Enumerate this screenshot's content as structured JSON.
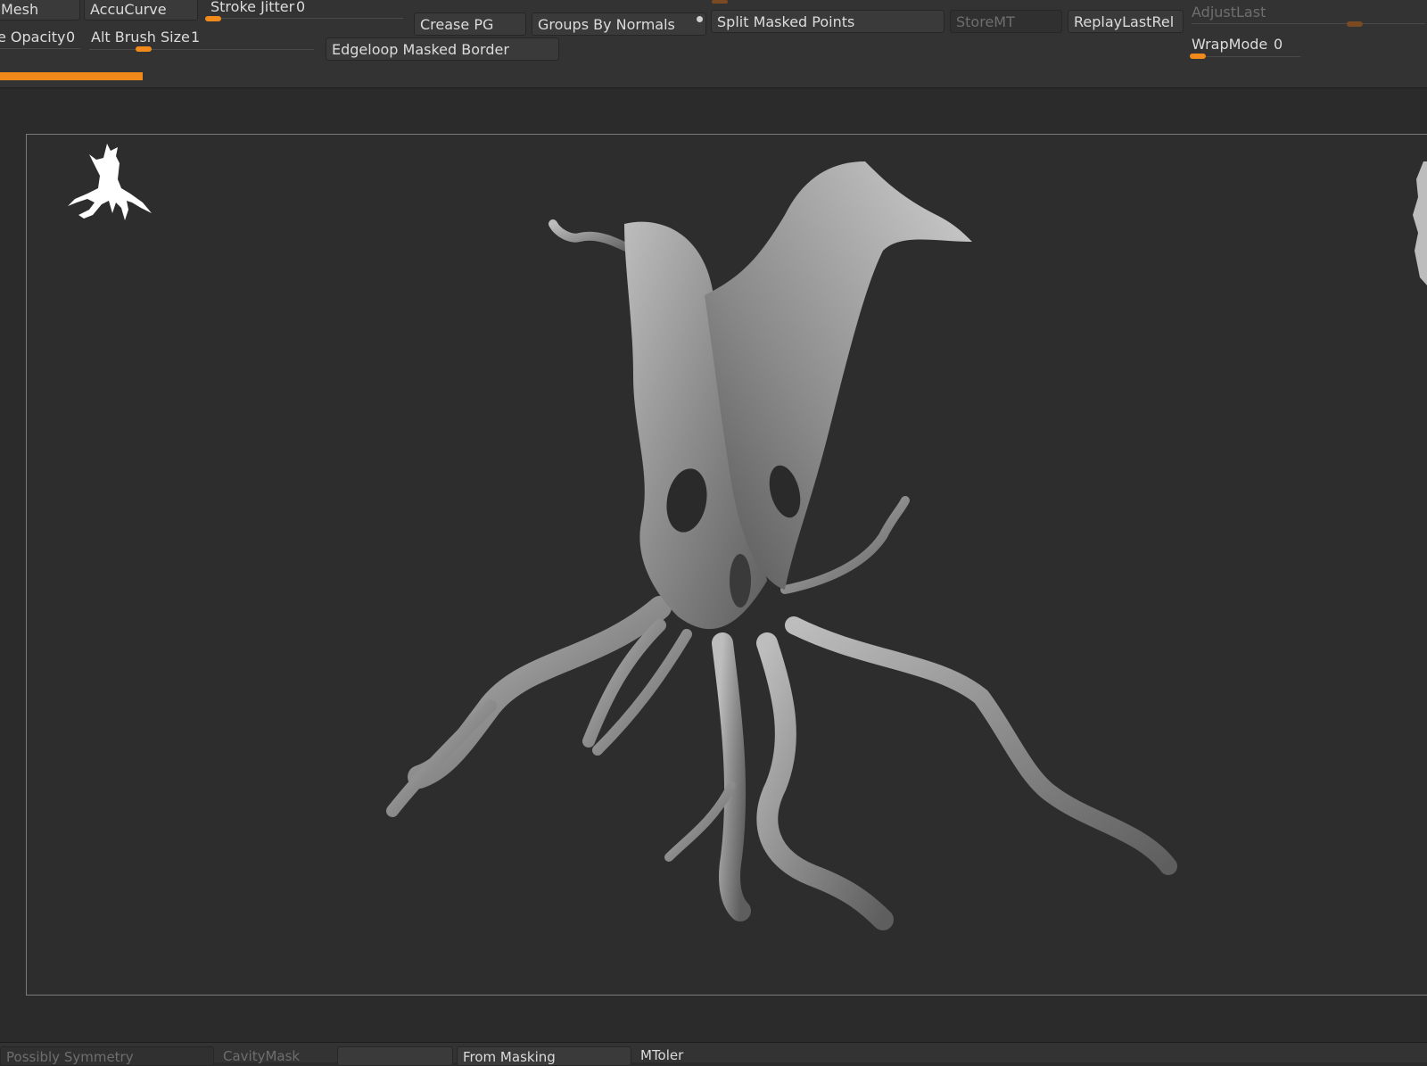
{
  "toolbar": {
    "row1": {
      "mesh": "Mesh",
      "accucurve": "AccuCurve",
      "stroke_jitter_label": "Stroke Jitter",
      "stroke_jitter_value": "0",
      "crease_pg": "Crease PG",
      "groups_by_normals": "Groups By Normals",
      "split_masked_points": "Split Masked Points",
      "store_mt": "StoreMT",
      "replay_last_rel": "ReplayLastRel",
      "adjust_last": "AdjustLast"
    },
    "row2": {
      "opacity_label": "e Opacity",
      "opacity_value": "0",
      "alt_brush_size_label": "Alt Brush Size",
      "alt_brush_size_value": "1",
      "edgeloop_masked_border": "Edgeloop Masked Border",
      "wrapmode_label": "WrapMode",
      "wrapmode_value": "0"
    },
    "progress_fraction": 0.1
  },
  "viewport": {
    "model_icon": "tree-silhouette-icon",
    "model": "dead-tree-sculpt"
  },
  "bottombar": {
    "symmetry": "Possibly Symmetry",
    "cavity_mask": "CavityMask",
    "from_masking": "From Masking",
    "mtoler": "MToler"
  },
  "colors": {
    "accent": "#f0891a",
    "panel": "#333333",
    "canvas": "#2d2d2d"
  }
}
